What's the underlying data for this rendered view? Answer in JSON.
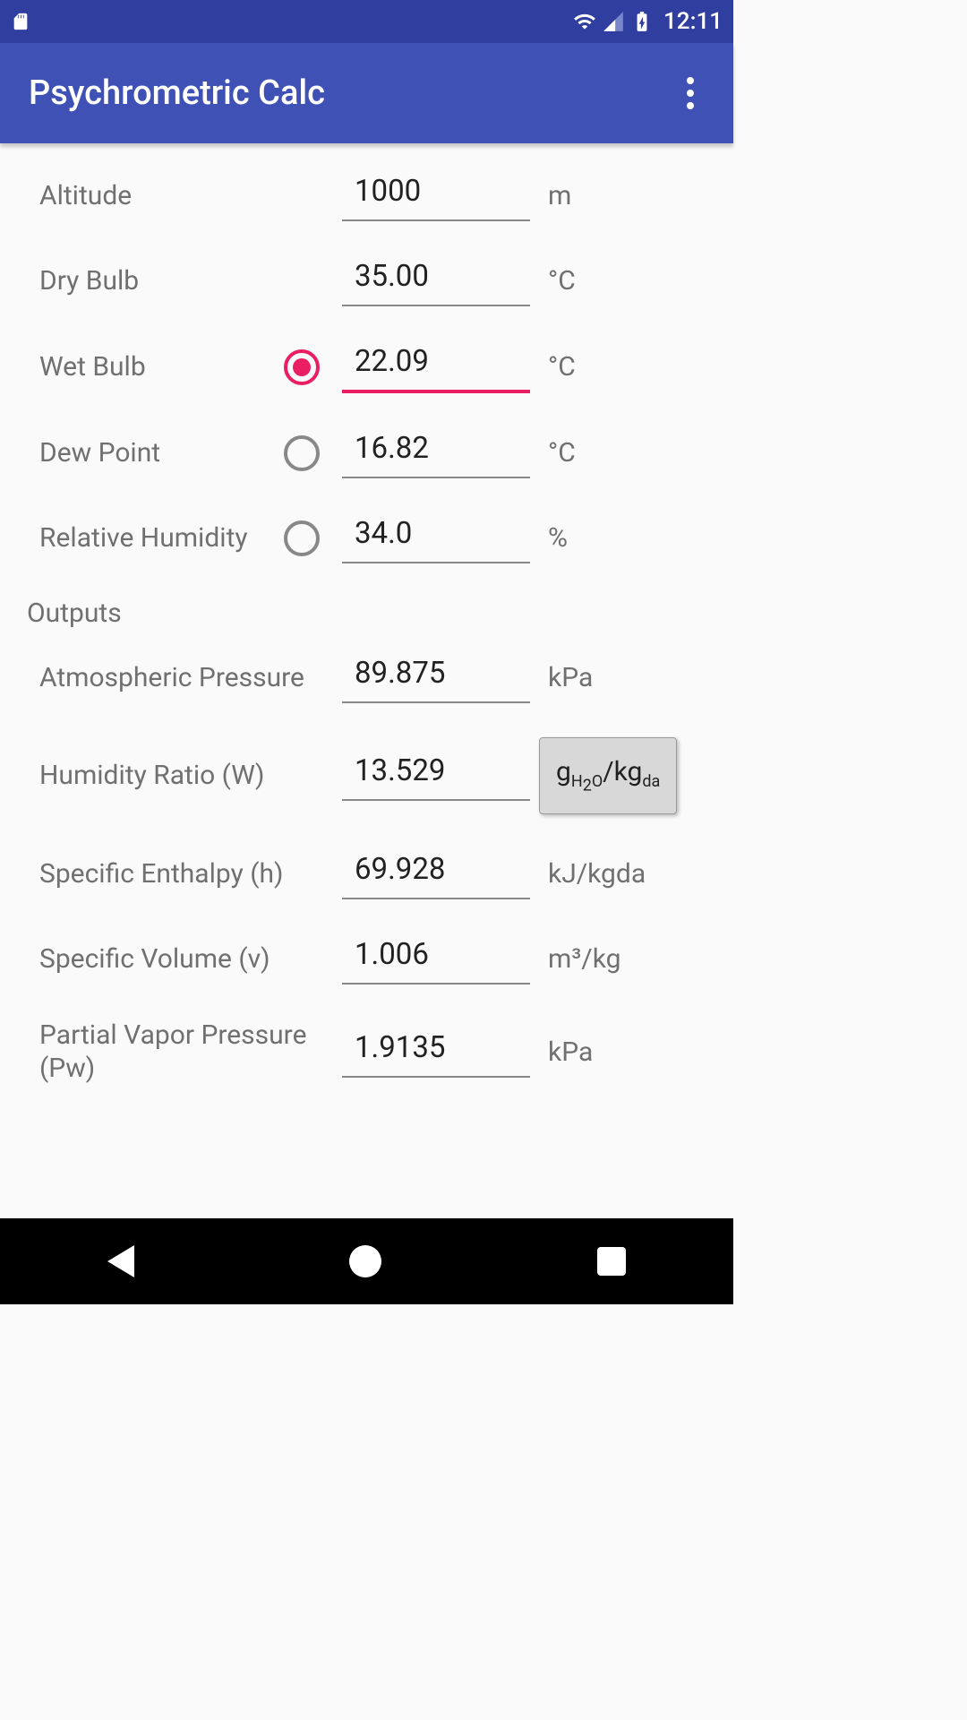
{
  "status": {
    "time": "12:11"
  },
  "app": {
    "title": "Psychrometric Calc"
  },
  "inputs": {
    "altitude": {
      "label": "Altitude",
      "value": "1000",
      "unit": "m"
    },
    "drybulb": {
      "label": "Dry Bulb",
      "value": "35.00",
      "unit": "°C"
    },
    "wetbulb": {
      "label": "Wet Bulb",
      "value": "22.09",
      "unit": "°C"
    },
    "dewpoint": {
      "label": "Dew Point",
      "value": "16.82",
      "unit": "°C"
    },
    "relhum": {
      "label": "Relative Humidity",
      "value": "34.0",
      "unit": "%"
    }
  },
  "outputs_header": "Outputs",
  "outputs": {
    "atmpress": {
      "label": "Atmospheric Pressure",
      "value": "89.875",
      "unit": "kPa"
    },
    "humratio": {
      "label": "Humidity Ratio (W)",
      "value": "13.529"
    },
    "enthalpy": {
      "label": "Specific Enthalpy (h)",
      "value": "69.928",
      "unit": "kJ/kgda"
    },
    "specvol": {
      "label": "Specific Volume (v)",
      "value": "1.006",
      "unit": "m³/kg"
    },
    "vappress": {
      "label": "Partial Vapor Pressure (Pw)",
      "value": "1.9135",
      "unit": "kPa"
    }
  }
}
